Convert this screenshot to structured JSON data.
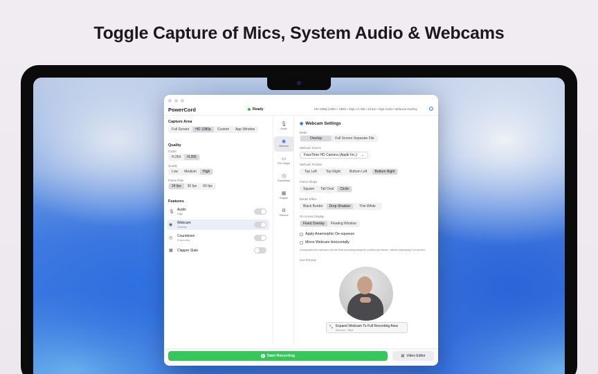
{
  "headline": "Toggle Capture of Mics, System Audio & Webcams",
  "app": {
    "name": "PowerCord",
    "status": "Ready",
    "status_color": "#2fbf5a",
    "summary": "HD 1080p (1920 × 1080) • High • H.265 • 24 fps • High Audio • Webcam Overlay"
  },
  "left": {
    "capture_area": {
      "title": "Capture Area",
      "options": [
        "Full Screen",
        "HD 1080p",
        "Custom",
        "App Window"
      ],
      "selected": "HD 1080p"
    },
    "quality": {
      "title": "Quality",
      "codec": {
        "label": "Codec",
        "options": [
          "H.264",
          "H.265"
        ],
        "selected": "H.265"
      },
      "quality": {
        "label": "Quality",
        "options": [
          "Low",
          "Medium",
          "High"
        ],
        "selected": "High"
      },
      "frame_rate": {
        "label": "Frame Rate",
        "options": [
          "24 fps",
          "30 fps",
          "60 fps"
        ],
        "selected": "24 fps"
      }
    },
    "features": {
      "title": "Features",
      "items": [
        {
          "label": "Audio",
          "sub": "High",
          "icon": "mic-icon",
          "on": true
        },
        {
          "label": "Webcam",
          "sub": "Overlay",
          "icon": "webcam-icon",
          "on": true
        },
        {
          "label": "Countdown",
          "sub": "3 seconds",
          "icon": "timer-icon",
          "on": true
        },
        {
          "label": "Clapper Slate",
          "sub": "",
          "icon": "clapper-icon",
          "on": false
        }
      ]
    }
  },
  "rail": {
    "items": [
      {
        "label": "Audio",
        "icon": "mic-icon"
      },
      {
        "label": "Webcam",
        "icon": "webcam-icon",
        "selected": true
      },
      {
        "label": "File Output",
        "icon": "folder-icon"
      },
      {
        "label": "Countdown",
        "icon": "timer-icon"
      },
      {
        "label": "Clapper",
        "icon": "clapper-icon"
      },
      {
        "label": "General",
        "icon": "gear-icon"
      }
    ]
  },
  "webcam": {
    "title": "Webcam Settings",
    "mode": {
      "label": "Mode",
      "options": [
        "Overlay",
        "Full Screen Separate File"
      ],
      "selected": "Overlay"
    },
    "source": {
      "label": "Webcam Source",
      "value": "FaceTime HD Camera (Apple Inc.)"
    },
    "position": {
      "label": "Webcam Position",
      "options": [
        "Top Left",
        "Top Right",
        "Bottom Left",
        "Bottom Right"
      ],
      "selected": "Bottom Right"
    },
    "shape": {
      "label": "Frame Shape",
      "options": [
        "Square",
        "Tall Oval",
        "Circle"
      ],
      "selected": "Circle"
    },
    "border": {
      "label": "Border Effect",
      "options": [
        "Black Border",
        "Drop Shadow",
        "Thin White"
      ],
      "selected": "Drop Shadow"
    },
    "display": {
      "label": "On-Screen Display",
      "options": [
        "Fixed Overlay",
        "Floating Window"
      ],
      "selected": "Fixed Overlay"
    },
    "checks": [
      "Apply Anamorphic De-squeeze",
      "Mirror Webcam Horizontally"
    ],
    "description": "Composites the webcam into the final recording using the position set above, without displaying it on screen.",
    "preview_label": "Live Preview",
    "expand_label": "Expand Webcam To Full Recording Area",
    "expand_shortcut": "Shortcut: ⇧⌘W"
  },
  "bottom": {
    "start_label": "Start Recording",
    "editor_label": "Video Editor",
    "accent": "#34c759"
  }
}
